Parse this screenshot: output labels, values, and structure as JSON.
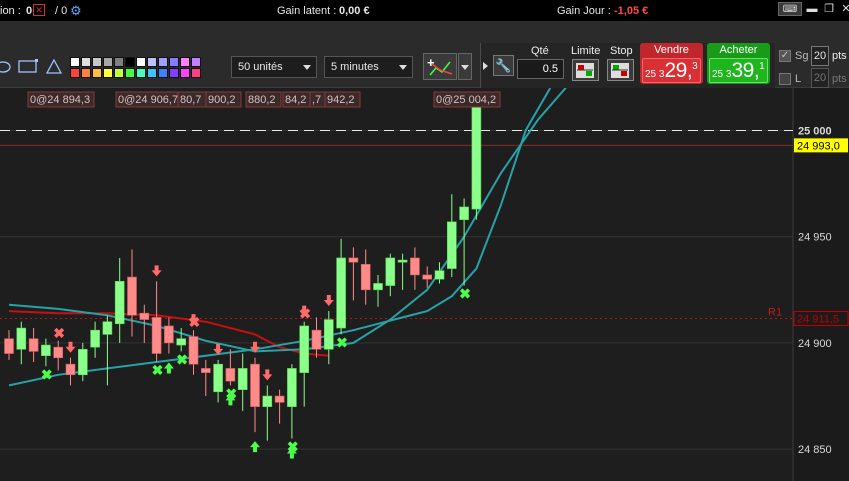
{
  "topbar": {
    "left_label": "ion :",
    "left_value": "0",
    "left_sep": "/ 0",
    "gain_latent_label": "Gain latent :",
    "gain_latent_value": "0,00 €",
    "gain_jour_label": "Gain Jour :",
    "gain_jour_value": "-1,05 €",
    "icons": [
      "close-square-icon",
      "gear-icon",
      "keyboard-icon",
      "minimize-icon",
      "restore-icon",
      "close-icon"
    ]
  },
  "toolbar": {
    "quantity_select": "50 unités",
    "timeframe_select": "5 minutes",
    "qte_label": "Qté",
    "qte_value": "0.5",
    "limite_label": "Limite",
    "stop_label": "Stop",
    "vendre": {
      "label": "Vendre",
      "prefix": "25 3",
      "big": "29,",
      "sup": "3"
    },
    "acheter": {
      "label": "Acheter",
      "prefix": "25 3",
      "big": "39,",
      "sup": "1"
    },
    "sg_label": "Sg",
    "sg_value": "20",
    "l_label": "L",
    "l_value": "20",
    "pts_label": "pts",
    "palette_colors": [
      "#ffffff",
      "#e0e0e0",
      "#c8c8c8",
      "#a8a8a8",
      "#808080",
      "#000000",
      "#ffffff",
      "#c0c0ff",
      "#a0a0ff",
      "#8080ff",
      "#ff80ff",
      "#c080ff",
      "#ff4040",
      "#ff8040",
      "#ffc040",
      "#ffff40",
      "#c0ff40",
      "#40ff40",
      "#40ffc0",
      "#40c0ff",
      "#4080ff",
      "#8040ff",
      "#ff40ff",
      "#ff4080"
    ],
    "icons": [
      "circle-tool-icon",
      "rectangle-tool-icon",
      "triangle-tool-icon",
      "indicator-icon",
      "wrench-icon",
      "limit-order-icon",
      "stop-order-icon"
    ]
  },
  "chart_data": {
    "type": "candlestick",
    "y_axis": {
      "min": 24835,
      "max": 25020,
      "ticks": [
        "25 000",
        "24 950",
        "24 900",
        "24 850"
      ]
    },
    "price_tags": [
      {
        "label": "24 993,0",
        "value": 24993.0,
        "color": "#ffff00"
      },
      {
        "label": "24 911,5",
        "value": 24911.5,
        "color": "#c00000"
      }
    ],
    "level_line": {
      "label": "R1",
      "value": 24911.5
    },
    "dashed_level": 25000,
    "position_tags": [
      "0@24 894,3",
      "0@24 906,7",
      "80,7",
      "900,2",
      "880,2",
      "84,2",
      ",7",
      "942,2",
      "0@25 004,2"
    ],
    "candles": [
      {
        "o": 24902,
        "c": 24895,
        "h": 24906,
        "l": 24892
      },
      {
        "o": 24897,
        "c": 24907,
        "h": 24910,
        "l": 24890
      },
      {
        "o": 24902,
        "c": 24896,
        "h": 24907,
        "l": 24891
      },
      {
        "o": 24894,
        "c": 24899,
        "h": 24902,
        "l": 24889
      },
      {
        "o": 24898,
        "c": 24893,
        "h": 24901,
        "l": 24887
      },
      {
        "o": 24890,
        "c": 24885,
        "h": 24893,
        "l": 24880
      },
      {
        "o": 24885,
        "c": 24897,
        "h": 24900,
        "l": 24882
      },
      {
        "o": 24898,
        "c": 24906,
        "h": 24910,
        "l": 24893
      },
      {
        "o": 24904,
        "c": 24910,
        "h": 24913,
        "l": 24880
      },
      {
        "o": 24909,
        "c": 24929,
        "h": 24940,
        "l": 24900
      },
      {
        "o": 24931,
        "c": 24913,
        "h": 24944,
        "l": 24903
      },
      {
        "o": 24914,
        "c": 24911,
        "h": 24918,
        "l": 24900
      },
      {
        "o": 24912,
        "c": 24895,
        "h": 24929,
        "l": 24891
      },
      {
        "o": 24908,
        "c": 24900,
        "h": 24912,
        "l": 24895
      },
      {
        "o": 24899,
        "c": 24902,
        "h": 24907,
        "l": 24896
      },
      {
        "o": 24903,
        "c": 24890,
        "h": 24906,
        "l": 24885
      },
      {
        "o": 24888,
        "c": 24886,
        "h": 24892,
        "l": 24875
      },
      {
        "o": 24877,
        "c": 24890,
        "h": 24892,
        "l": 24872
      },
      {
        "o": 24888,
        "c": 24882,
        "h": 24897,
        "l": 24880
      },
      {
        "o": 24878,
        "c": 24888,
        "h": 24895,
        "l": 24868
      },
      {
        "o": 24890,
        "c": 24870,
        "h": 24893,
        "l": 24858
      },
      {
        "o": 24870,
        "c": 24875,
        "h": 24880,
        "l": 24854
      },
      {
        "o": 24875,
        "c": 24872,
        "h": 24878,
        "l": 24862
      },
      {
        "o": 24870,
        "c": 24888,
        "h": 24890,
        "l": 24855
      },
      {
        "o": 24886,
        "c": 24908,
        "h": 24910,
        "l": 24870
      },
      {
        "o": 24906,
        "c": 24897,
        "h": 24912,
        "l": 24893
      },
      {
        "o": 24897,
        "c": 24911,
        "h": 24915,
        "l": 24890
      },
      {
        "o": 24907,
        "c": 24940,
        "h": 24949,
        "l": 24904
      },
      {
        "o": 24940,
        "c": 24938,
        "h": 24945,
        "l": 24920
      },
      {
        "o": 24937,
        "c": 24925,
        "h": 24944,
        "l": 24918
      },
      {
        "o": 24925,
        "c": 24928,
        "h": 24932,
        "l": 24917
      },
      {
        "o": 24927,
        "c": 24940,
        "h": 24942,
        "l": 24922
      },
      {
        "o": 24938,
        "c": 24939,
        "h": 24942,
        "l": 24925
      },
      {
        "o": 24940,
        "c": 24932,
        "h": 24945,
        "l": 24925
      },
      {
        "o": 24932,
        "c": 24930,
        "h": 24936,
        "l": 24926
      },
      {
        "o": 24930,
        "c": 24934,
        "h": 24938,
        "l": 24928
      },
      {
        "o": 24935,
        "c": 24957,
        "h": 24970,
        "l": 24931
      },
      {
        "o": 24958,
        "c": 24964,
        "h": 24968,
        "l": 24927
      },
      {
        "o": 24963,
        "c": 25011,
        "h": 25018,
        "l": 24958
      }
    ],
    "series": [
      {
        "color": "#c81010",
        "points": [
          [
            0,
            24915
          ],
          [
            4,
            24914
          ],
          [
            8,
            24914
          ],
          [
            12,
            24913
          ],
          [
            16,
            24910
          ],
          [
            20,
            24904
          ],
          [
            22,
            24898
          ],
          [
            24,
            24895
          ],
          [
            26,
            24894
          ]
        ]
      },
      {
        "color": "#27a3a8",
        "points": [
          [
            0,
            24880
          ],
          [
            4,
            24885
          ],
          [
            8,
            24888
          ],
          [
            12,
            24891
          ],
          [
            16,
            24894
          ],
          [
            20,
            24897
          ],
          [
            24,
            24901
          ],
          [
            28,
            24906
          ],
          [
            32,
            24912
          ],
          [
            34,
            24915
          ],
          [
            36,
            24922
          ],
          [
            38,
            24935
          ],
          [
            40,
            24965
          ],
          [
            42,
            25000
          ],
          [
            44,
            25020
          ]
        ]
      },
      {
        "color": "#27a3a8",
        "points": [
          [
            0,
            24918
          ],
          [
            4,
            24916
          ],
          [
            8,
            24913
          ],
          [
            12,
            24908
          ],
          [
            16,
            24901
          ],
          [
            20,
            24896
          ],
          [
            24,
            24897
          ],
          [
            28,
            24900
          ],
          [
            31,
            24911
          ],
          [
            34,
            24925
          ],
          [
            37,
            24950
          ],
          [
            40,
            24980
          ],
          [
            43,
            25005
          ],
          [
            46,
            25025
          ]
        ]
      }
    ]
  }
}
